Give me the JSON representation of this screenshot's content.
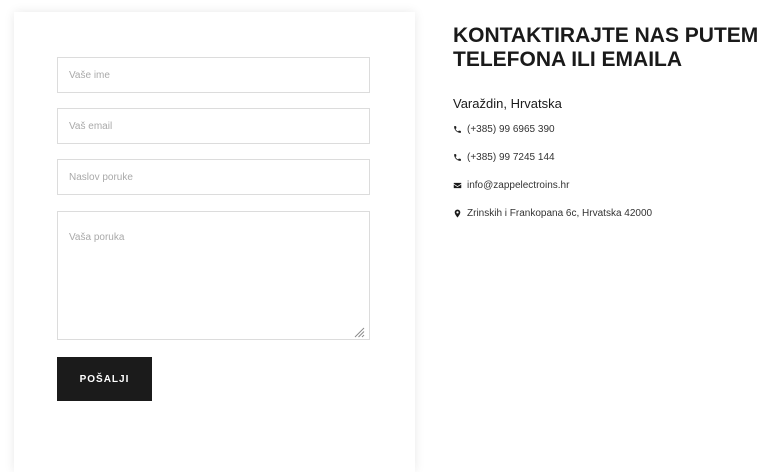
{
  "form": {
    "name_placeholder": "Vaše ime",
    "email_placeholder": "Vaš email",
    "subject_placeholder": "Naslov poruke",
    "message_placeholder": "Vaša poruka",
    "submit_label": "POŠALJI"
  },
  "contact": {
    "title": "KONTAKTIRAJTE NAS PUTEM TELEFONA ILI EMAILA",
    "city": "Varaždin, Hrvatska",
    "phone_1": "(+385) 99 6965 390",
    "phone_2": "(+385) 99 7245 144",
    "email": "info@zappelectroins.hr",
    "address": "Zrinskih i Frankopana 6c, Hrvatska 42000",
    "icons": {
      "phone": "phone-icon",
      "email": "envelope-icon",
      "address": "map-marker-icon"
    }
  },
  "colors": {
    "button_bg": "#1b1b1b",
    "text": "#1a1a1a",
    "border": "#dcdcdc",
    "placeholder": "#a9a9a9"
  }
}
